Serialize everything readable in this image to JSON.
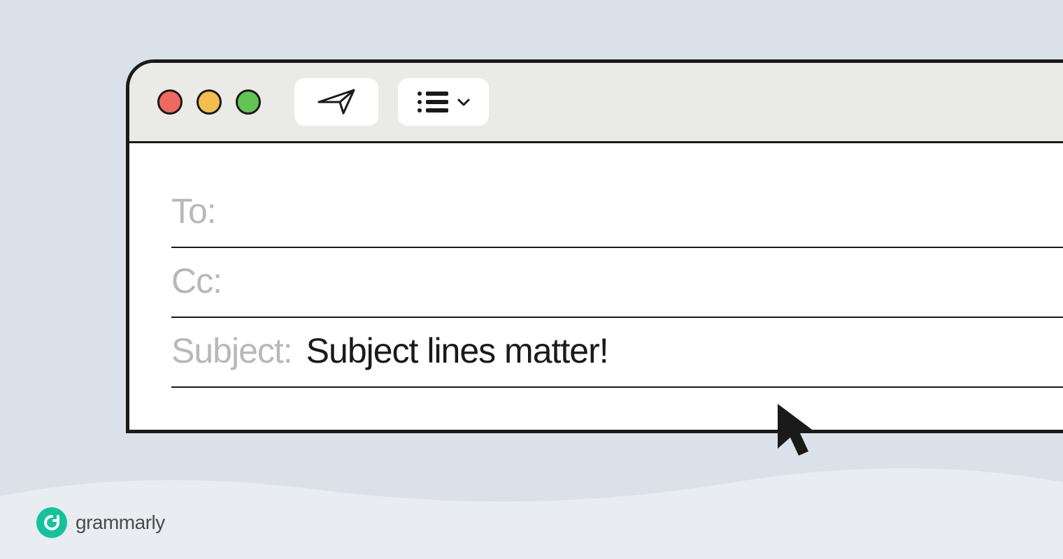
{
  "fields": {
    "to_label": "To:",
    "to_value": "",
    "cc_label": "Cc:",
    "cc_value": "",
    "subject_label": "Subject:",
    "subject_value": "Subject lines matter!"
  },
  "brand": {
    "name": "grammarly"
  },
  "colors": {
    "background": "#dbe1e8",
    "window_bg": "#ffffff",
    "titlebar_bg": "#eaeae6",
    "border": "#1a1a1a",
    "label": "#b8b8b8",
    "text": "#1a1a1a",
    "traffic_red": "#ee6a5e",
    "traffic_yellow": "#f5bd4f",
    "traffic_green": "#61c454",
    "brand_green": "#15c39a"
  },
  "icons": {
    "send": "paper-plane-icon",
    "list": "list-icon",
    "chevron": "chevron-down-icon",
    "cursor": "cursor-icon"
  }
}
